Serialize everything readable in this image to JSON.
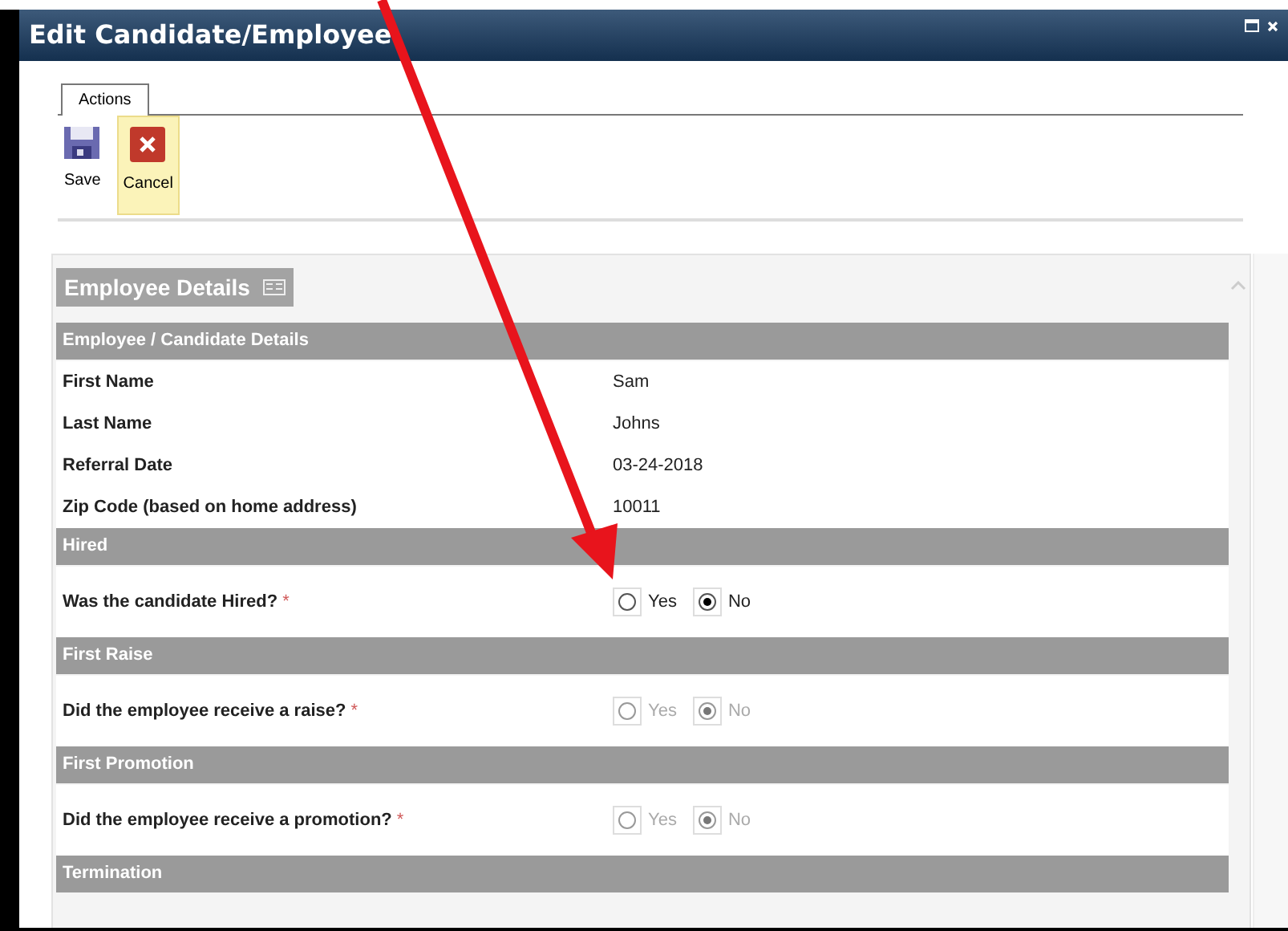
{
  "window": {
    "title": "Edit Candidate/Employee"
  },
  "tabs": [
    {
      "label": "Actions",
      "selected": true
    }
  ],
  "toolbar": [
    {
      "kind": "save",
      "label": "Save",
      "highlighted": false
    },
    {
      "kind": "cancel",
      "label": "Cancel",
      "highlighted": true
    }
  ],
  "panel": {
    "title": "Employee Details"
  },
  "sections": [
    {
      "title": "Employee / Candidate Details",
      "fields": [
        {
          "kind": "text",
          "label": "First Name",
          "value": "Sam"
        },
        {
          "kind": "text",
          "label": "Last Name",
          "value": "Johns"
        },
        {
          "kind": "text",
          "label": "Referral Date",
          "value": "03-24-2018"
        },
        {
          "kind": "text",
          "label": "Zip Code (based on home address)",
          "value": "10011"
        }
      ]
    },
    {
      "title": "Hired",
      "fields": [
        {
          "kind": "radio",
          "label": "Was the candidate Hired?",
          "required_mark": "*",
          "disabled": false,
          "options": [
            {
              "label": "Yes",
              "selected": false
            },
            {
              "label": "No",
              "selected": true
            }
          ]
        }
      ]
    },
    {
      "title": "First Raise",
      "fields": [
        {
          "kind": "radio",
          "label": "Did the employee receive a raise?",
          "required_mark": "*",
          "disabled": true,
          "options": [
            {
              "label": "Yes",
              "selected": false
            },
            {
              "label": "No",
              "selected": true
            }
          ]
        }
      ]
    },
    {
      "title": "First Promotion",
      "fields": [
        {
          "kind": "radio",
          "label": "Did the employee receive a promotion?",
          "required_mark": "*",
          "disabled": true,
          "options": [
            {
              "label": "Yes",
              "selected": false
            },
            {
              "label": "No",
              "selected": true
            }
          ]
        }
      ]
    },
    {
      "title": "Termination"
    }
  ]
}
